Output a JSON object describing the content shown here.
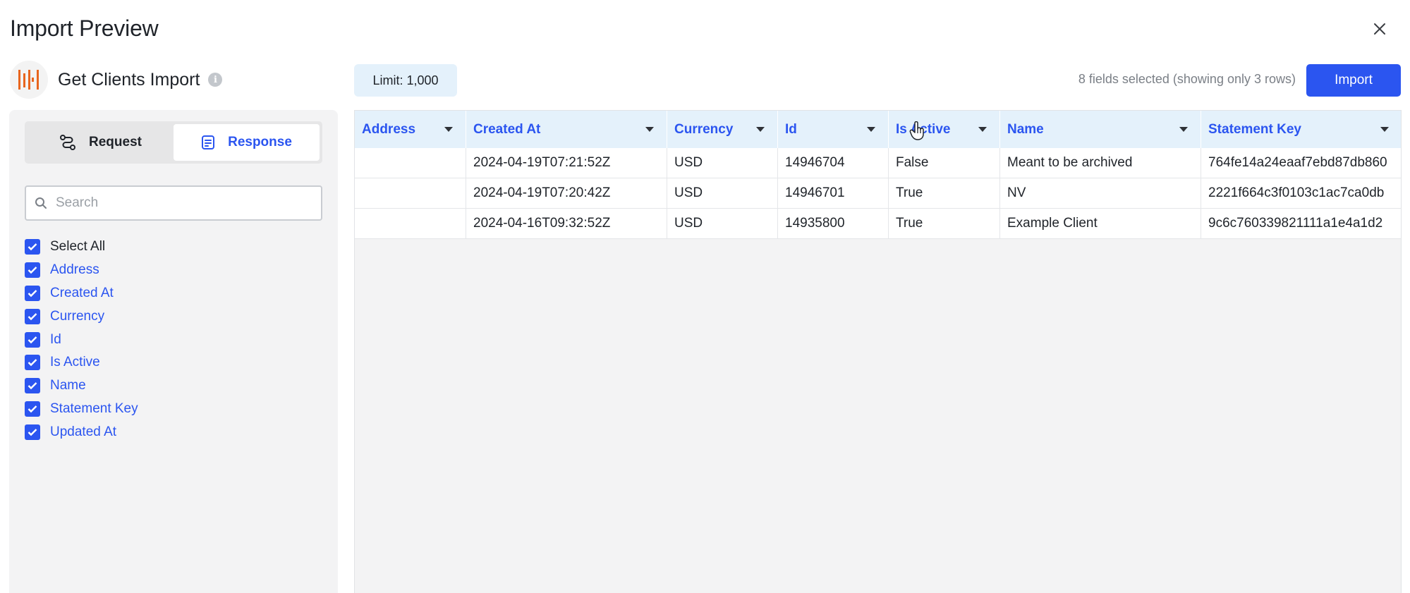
{
  "modal": {
    "title": "Import Preview"
  },
  "integration": {
    "name": "Get Clients Import"
  },
  "toolbar": {
    "limit_label": "Limit: 1,000",
    "fields_summary": "8 fields selected (showing only 3 rows)",
    "import_label": "Import"
  },
  "tabs": [
    {
      "label": "Request",
      "icon": "route-icon",
      "active": false
    },
    {
      "label": "Response",
      "icon": "document-icon",
      "active": true
    }
  ],
  "search": {
    "placeholder": "Search",
    "value": ""
  },
  "fields": [
    {
      "label": "Select All",
      "checked": true
    },
    {
      "label": "Address",
      "checked": true
    },
    {
      "label": "Created At",
      "checked": true
    },
    {
      "label": "Currency",
      "checked": true
    },
    {
      "label": "Id",
      "checked": true
    },
    {
      "label": "Is Active",
      "checked": true
    },
    {
      "label": "Name",
      "checked": true
    },
    {
      "label": "Statement Key",
      "checked": true
    },
    {
      "label": "Updated At",
      "checked": true
    }
  ],
  "table": {
    "columns": [
      "Address",
      "Created At",
      "Currency",
      "Id",
      "Is Active",
      "Name",
      "Statement Key"
    ],
    "rows": [
      [
        "",
        "2024-04-19T07:21:52Z",
        "USD",
        "14946704",
        "False",
        "Meant to be archived",
        "764fe14a24eaaf7ebd87db860"
      ],
      [
        "",
        "2024-04-19T07:20:42Z",
        "USD",
        "14946701",
        "True",
        "NV",
        "2221f664c3f0103c1ac7ca0db"
      ],
      [
        "",
        "2024-04-16T09:32:52Z",
        "USD",
        "14935800",
        "True",
        "Example Client",
        "9c6c760339821111a1e4a1d2"
      ]
    ]
  },
  "colors": {
    "accent": "#2b55f0",
    "header_bg": "#e4f1fb",
    "panel_bg": "#f3f3f4",
    "logo_orange": "#e8651e"
  }
}
